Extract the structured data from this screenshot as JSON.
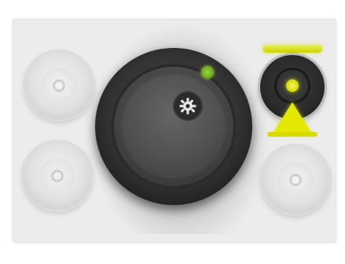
{
  "figure": {
    "caption_code": "",
    "highlight_color": "#e4e800",
    "status_color": "#7bbf22"
  },
  "controls": {
    "main_dial": {
      "icon": "gear-icon"
    },
    "indicator": {
      "icon": "status-led-icon",
      "state": "green"
    },
    "top_right_button": {
      "highlighted": true,
      "icon": "push-button-icon"
    },
    "other_knobs": [
      "top-left-knob",
      "bottom-left-knob",
      "bottom-right-knob"
    ]
  },
  "callout": {
    "type": "arrow-up",
    "icon": "highlight-arrow-icon"
  }
}
